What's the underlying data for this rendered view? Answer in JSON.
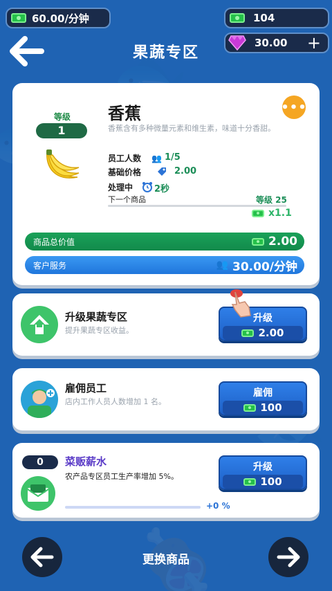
{
  "top_bar": {
    "income_rate": "60.00/分钟",
    "cash": "104",
    "gems": "30.00",
    "add_symbol": "+"
  },
  "header": {
    "title": "果蔬专区"
  },
  "product": {
    "level_label": "等级",
    "level": "1",
    "name": "香蕉",
    "description": "香蕉含有多种微量元素和维生素，味道十分香甜。",
    "employees_label": "员工人数",
    "employees_value": "1/5",
    "base_price_label": "基础价格",
    "base_price_value": "2.00",
    "processing_label": "处理中",
    "processing_value": "2秒",
    "next_product_label": "下一个商品",
    "next_level_label": "等级 25",
    "next_multiplier": "x1.1",
    "next_product_progress": 0.0,
    "total_value_label": "商品总价值",
    "total_value": "2.00",
    "customer_service_label": "客户服务",
    "customer_service_value": "30.00/分钟"
  },
  "upgrades": [
    {
      "title": "升级果蔬专区",
      "description": "提升果蔬专区收益。",
      "button_label": "升级",
      "price": "2.00"
    },
    {
      "title": "雇佣员工",
      "description": "店内工作人员人数增加 1 名。",
      "button_label": "雇佣",
      "price": "100"
    },
    {
      "level": "0",
      "title": "菜贩薪水",
      "description": "农产品专区员工生产率增加 5%。",
      "progress_text": "+0 %",
      "button_label": "升级",
      "price": "100"
    }
  ],
  "bottom_nav": {
    "label": "更换商品"
  },
  "colors": {
    "background": "#1f63b3",
    "accent_green": "#1c8e58",
    "accent_blue": "#2f7fe8",
    "gem": "#c93ad8",
    "more": "#f5a623"
  }
}
